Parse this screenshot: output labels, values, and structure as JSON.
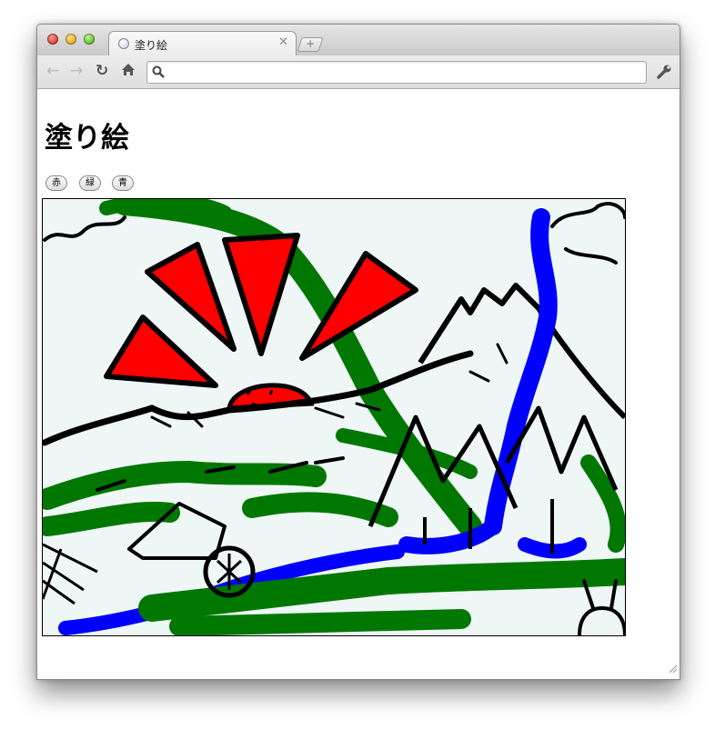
{
  "browser": {
    "tab": {
      "title": "塗り絵",
      "favicon": "globe-icon",
      "close_icon": "close-icon"
    },
    "new_tab_icon": "plus-icon",
    "toolbar": {
      "back_icon": "back-arrow-icon",
      "forward_icon": "forward-arrow-icon",
      "reload_icon": "reload-icon",
      "home_icon": "home-icon",
      "search_icon": "search-icon",
      "settings_icon": "wrench-icon",
      "address_value": ""
    }
  },
  "page": {
    "title": "塗り絵",
    "buttons": [
      {
        "label": "赤",
        "color": "#ff0000"
      },
      {
        "label": "緑",
        "color": "#007700"
      },
      {
        "label": "青",
        "color": "#0000ff"
      }
    ],
    "canvas": {
      "background_color": "#eef6f6",
      "stroke_colors": [
        "#000000",
        "#ff0000",
        "#007700",
        "#0000ff"
      ]
    }
  }
}
